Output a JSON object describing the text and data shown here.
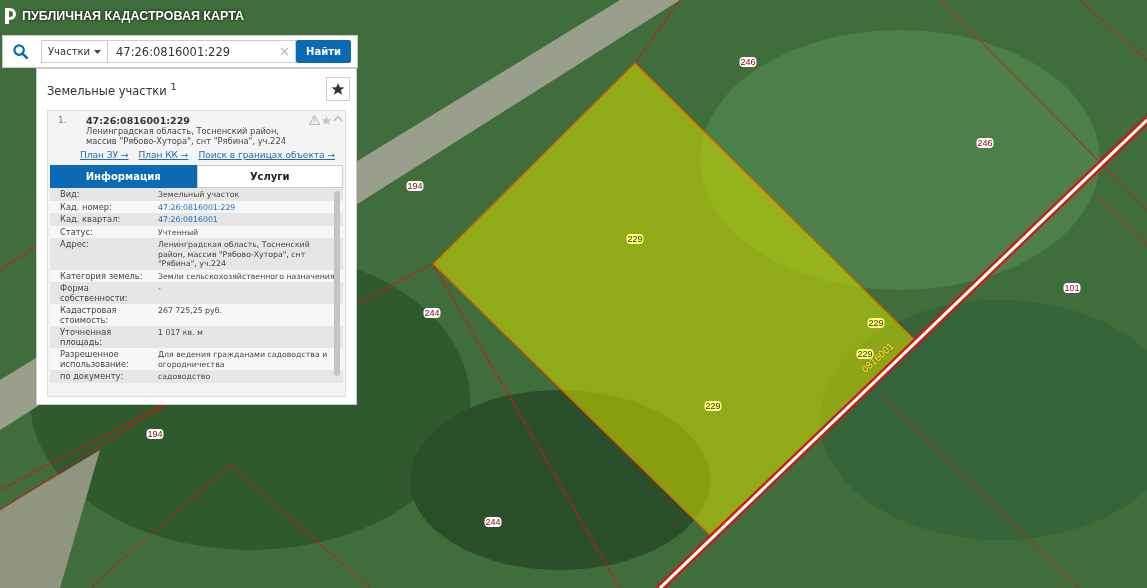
{
  "header": {
    "title": "ПУБЛИЧНАЯ КАДАСТРОВАЯ КАРТА"
  },
  "search": {
    "scope": "Участки",
    "value": "47:26:0816001:229",
    "button": "Найти"
  },
  "results": {
    "title": "Земельные участки $^{1}$",
    "favorite": false,
    "items": [
      {
        "index": "1.",
        "number": "47:26:0816001:229",
        "address": "Ленинградская область, Тосненский район, массив \"Рябово-Хутора\", снт \"Рябина\", уч.224",
        "expanded": true,
        "links": [
          "План ЗУ →",
          "План КК →",
          "Поиск в границах объекта →"
        ],
        "tabs": [
          {
            "label": "Информация",
            "selected": true
          },
          {
            "label": "Услуги",
            "selected": false
          }
        ],
        "rows": [
          {
            "label": "Вид:",
            "value": "Земельный участок",
            "kind": "text"
          },
          {
            "label": "Кад. номер:",
            "value": "47:26:0816001:229",
            "kind": "link"
          },
          {
            "label": "Кад. квартал:",
            "value": "47:26:0816001",
            "kind": "link"
          },
          {
            "label": "Статус:",
            "value": "Учтенный",
            "kind": "text"
          },
          {
            "label": "Адрес:",
            "value": "Ленинградская область, Тосненский район, массив \"Рябово-Хутора\", снт \"Рябина\", уч.224",
            "kind": "text"
          },
          {
            "label": "Категория земель:",
            "value": "Земли сельскохозяйственного назначения",
            "kind": "text"
          },
          {
            "label": "Форма собственности:",
            "value": "-",
            "kind": "text"
          },
          {
            "label": "Кадастровая стоимость:",
            "value": "267 725,25 руб.",
            "kind": "text"
          },
          {
            "label": "Уточненная площадь:",
            "value": "1 017 кв. м",
            "kind": "text"
          },
          {
            "label": "Разрешенное использование:",
            "value": "Для ведения гражданами садоводства и огородничества",
            "kind": "text"
          },
          {
            "label": "по документу:",
            "value": "садоводство",
            "kind": "text"
          }
        ]
      }
    ]
  },
  "map": {
    "labels": [
      {
        "text": "246",
        "kind": "parcel"
      },
      {
        "text": "246",
        "kind": "parcel"
      },
      {
        "text": "194",
        "kind": "parcel"
      },
      {
        "text": "229",
        "kind": "selected"
      },
      {
        "text": "101",
        "kind": "parcel"
      },
      {
        "text": "244",
        "kind": "parcel"
      },
      {
        "text": "229",
        "kind": "selected"
      },
      {
        "text": "229",
        "kind": "selected"
      },
      {
        "text": "229",
        "kind": "selected"
      },
      {
        "text": "194",
        "kind": "parcel"
      },
      {
        "text": "244",
        "kind": "parcel"
      }
    ],
    "quarter_label": "0816001"
  }
}
